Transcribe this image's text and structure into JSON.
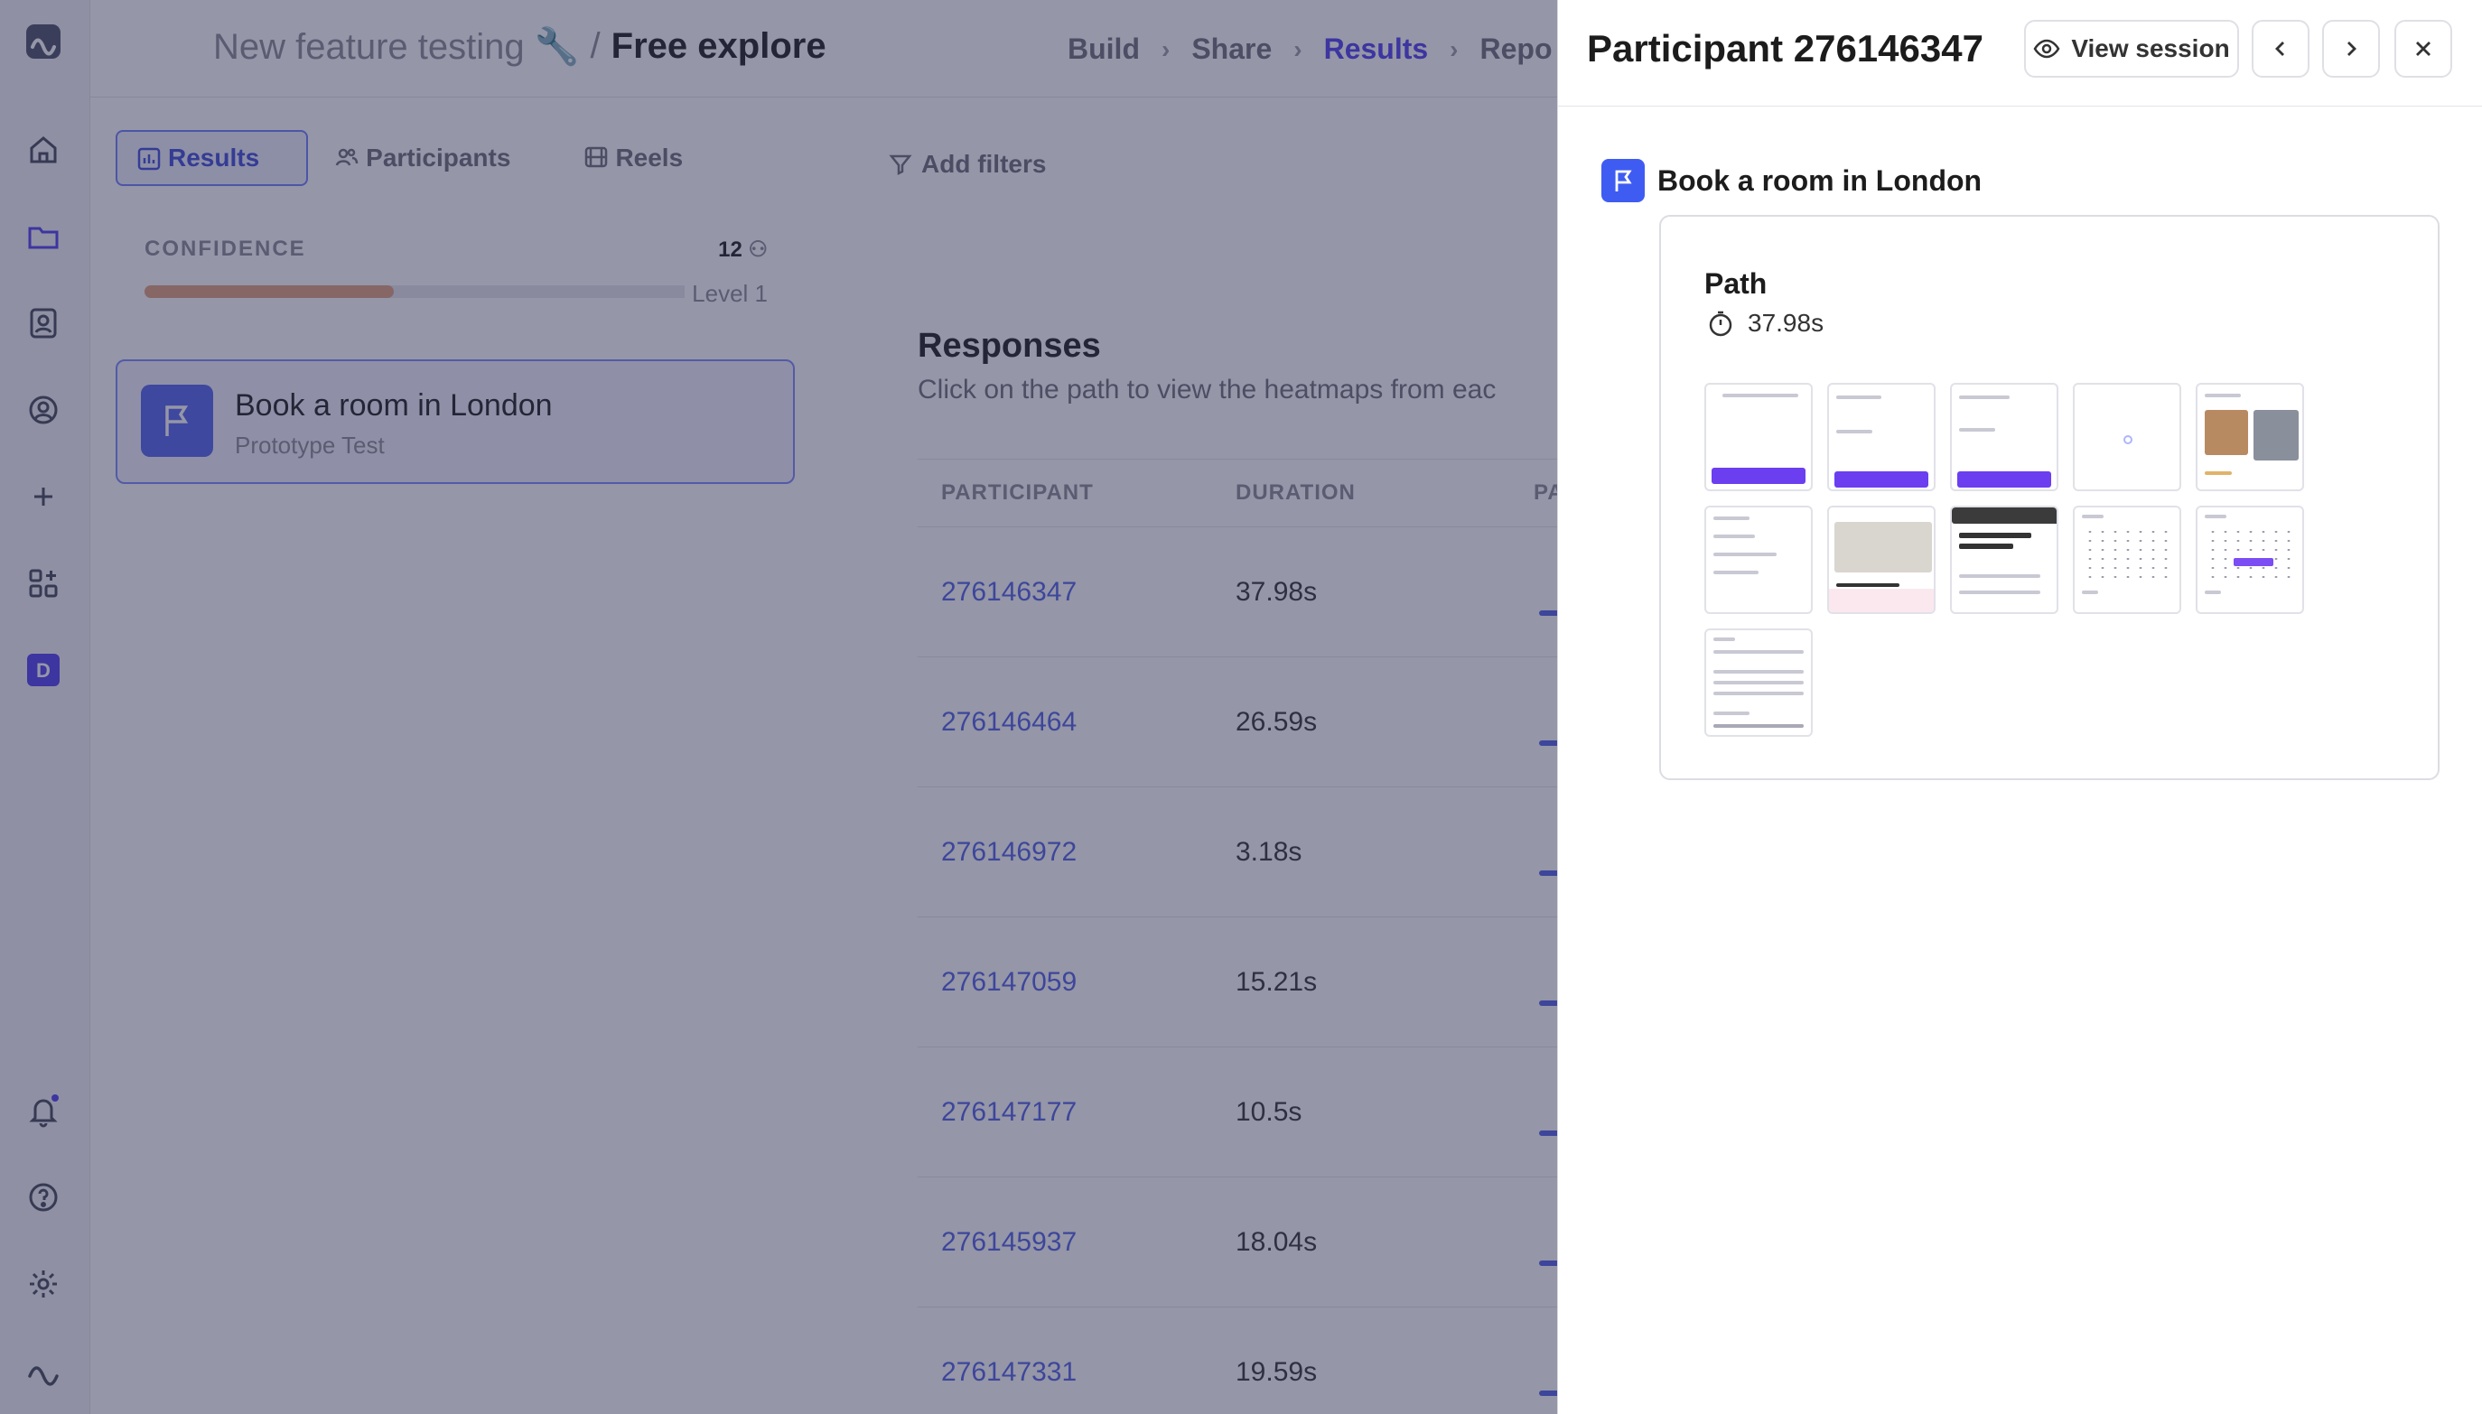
{
  "breadcrumb": {
    "project": "New feature testing 🔧",
    "separator": "/",
    "page": "Free explore"
  },
  "steps": [
    "Build",
    "Share",
    "Results",
    "Repo"
  ],
  "tabs": [
    {
      "label": "Results",
      "icon": "chart-icon"
    },
    {
      "label": "Participants",
      "icon": "people-icon"
    },
    {
      "label": "Reels",
      "icon": "film-icon"
    }
  ],
  "filters": {
    "label": "Add filters"
  },
  "confidence": {
    "label": "CONFIDENCE",
    "count": "12",
    "level": "Level 1",
    "progress": 0.4
  },
  "task": {
    "title": "Book a room in London",
    "subtitle": "Prototype Test"
  },
  "responses": {
    "title": "Responses",
    "subtitle": "Click on the path to view the heatmaps from eac"
  },
  "table": {
    "headers": [
      "PARTICIPANT",
      "DURATION",
      "PA"
    ],
    "rows": [
      {
        "id": "276146347",
        "duration": "37.98s"
      },
      {
        "id": "276146464",
        "duration": "26.59s"
      },
      {
        "id": "276146972",
        "duration": "3.18s"
      },
      {
        "id": "276147059",
        "duration": "15.21s"
      },
      {
        "id": "276147177",
        "duration": "10.5s"
      },
      {
        "id": "276145937",
        "duration": "18.04s"
      },
      {
        "id": "276147331",
        "duration": "19.59s"
      }
    ]
  },
  "panel": {
    "title": "Participant 276146347",
    "view_session": "View session",
    "task_title": "Book a room in London",
    "path_label": "Path",
    "path_duration": "37.98s"
  },
  "colors": {
    "accent": "#4f3df0",
    "task_blue": "#3f5cf2",
    "overlay": "#2b2d50"
  }
}
